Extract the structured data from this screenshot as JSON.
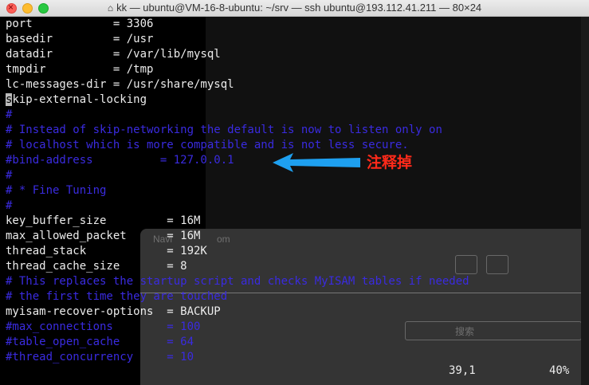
{
  "window": {
    "title": "kk — ubuntu@VM-16-8-ubuntu: ~/srv — ssh ubuntu@193.112.41.211 — 80×24",
    "home_icon": "home-icon"
  },
  "terminal": {
    "lines": [
      {
        "text": "port            = 3306",
        "style": "normal"
      },
      {
        "text": "basedir         = /usr",
        "style": "normal"
      },
      {
        "text": "datadir         = /var/lib/mysql",
        "style": "normal"
      },
      {
        "text": "tmpdir          = /tmp",
        "style": "normal"
      },
      {
        "text": "lc-messages-dir = /usr/share/mysql",
        "style": "normal"
      },
      {
        "text": "skip-external-locking",
        "style": "cursor"
      },
      {
        "text": "#",
        "style": "comment"
      },
      {
        "text": "# Instead of skip-networking the default is now to listen only on",
        "style": "comment"
      },
      {
        "text": "# localhost which is more compatible and is not less secure.",
        "style": "comment"
      },
      {
        "text": "#bind-address          = 127.0.0.1",
        "style": "comment"
      },
      {
        "text": "#",
        "style": "comment"
      },
      {
        "text": "# * Fine Tuning",
        "style": "comment"
      },
      {
        "text": "#",
        "style": "comment"
      },
      {
        "text": "key_buffer_size         = 16M",
        "style": "normal"
      },
      {
        "text": "max_allowed_packet      = 16M",
        "style": "normal"
      },
      {
        "text": "thread_stack            = 192K",
        "style": "normal"
      },
      {
        "text": "thread_cache_size       = 8",
        "style": "normal"
      },
      {
        "text": "# This replaces the startup script and checks MyISAM tables if needed",
        "style": "comment"
      },
      {
        "text": "# the first time they are touched",
        "style": "comment"
      },
      {
        "text": "myisam-recover-options  = BACKUP",
        "style": "normal"
      },
      {
        "text": "#max_connections        = 100",
        "style": "comment"
      },
      {
        "text": "#table_open_cache       = 64",
        "style": "comment"
      },
      {
        "text": "#thread_concurrency     = 10",
        "style": "comment"
      }
    ],
    "status": {
      "position": "39,1",
      "percent": "40%"
    }
  },
  "annotation": {
    "text": "注释掉",
    "color": "#ff2a1a"
  },
  "ghost_overlay": {
    "label_left": "Navi",
    "label_right": "om",
    "search": "搜索"
  },
  "colors": {
    "comment": "#3a2be0",
    "text": "#ececec",
    "arrow": "#1ea0f0"
  }
}
